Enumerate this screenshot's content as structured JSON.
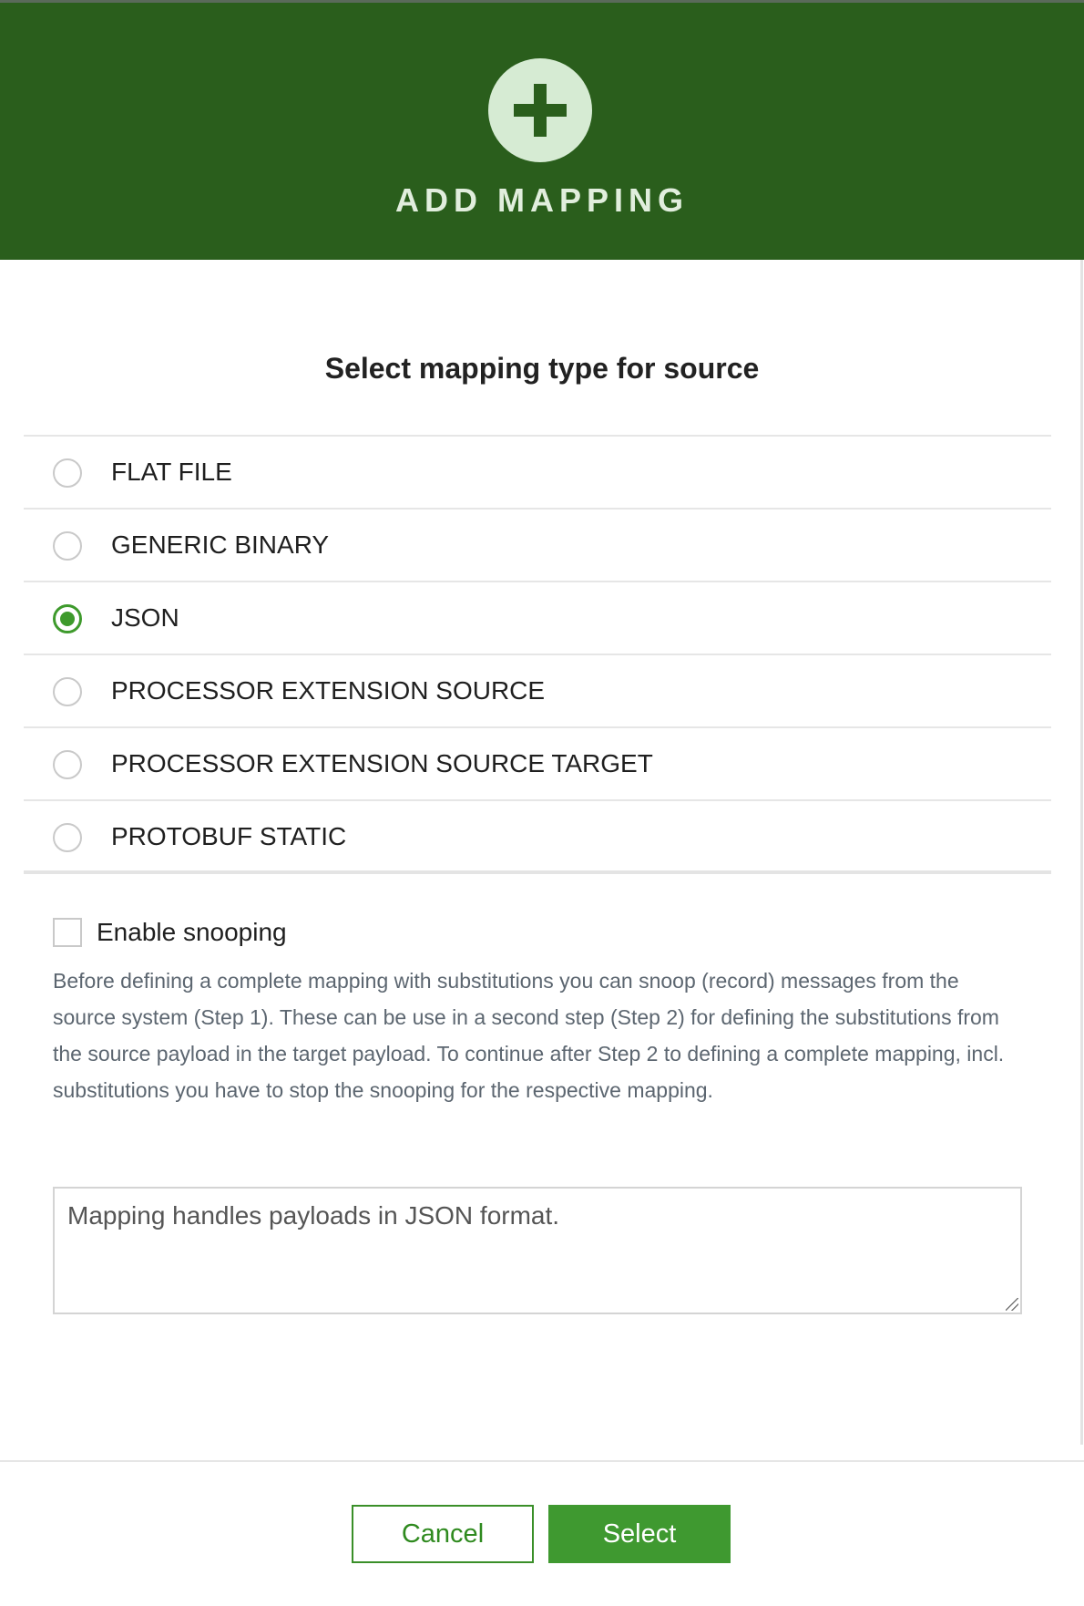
{
  "dialog": {
    "title": "ADD MAPPING",
    "header_icon": "plus-icon",
    "accent_color": "#2a5e1c",
    "select_color": "#3f9930"
  },
  "section": {
    "title": "Select mapping type for source"
  },
  "options": [
    {
      "label": "FLAT FILE",
      "checked": false
    },
    {
      "label": "GENERIC BINARY",
      "checked": false
    },
    {
      "label": "JSON",
      "checked": true
    },
    {
      "label": "PROCESSOR EXTENSION SOURCE",
      "checked": false
    },
    {
      "label": "PROCESSOR EXTENSION SOURCE TARGET",
      "checked": false
    },
    {
      "label": "PROTOBUF STATIC",
      "checked": false
    }
  ],
  "snooping": {
    "label": "Enable snooping",
    "checked": false,
    "help": "Before defining a complete mapping with substitutions you can snoop (record) messages from the source system (Step 1). These can be use in a second step (Step 2) for defining the substitutions from the source payload in the target payload. To continue after Step 2 to defining a complete mapping, incl. substitutions you have to stop the snooping for the respective mapping."
  },
  "description": {
    "value": "Mapping handles payloads in JSON format."
  },
  "footer": {
    "cancel_label": "Cancel",
    "select_label": "Select"
  }
}
